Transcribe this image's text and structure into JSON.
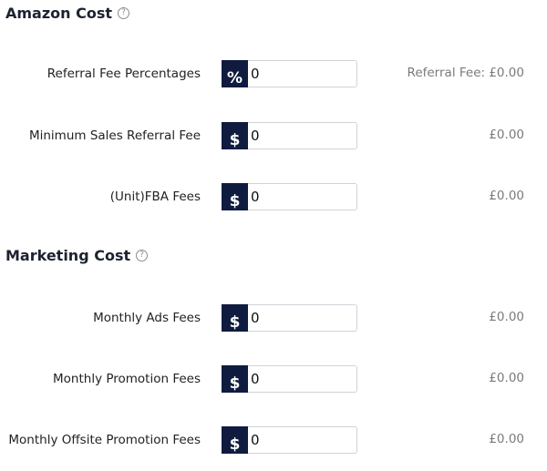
{
  "sections": [
    {
      "title": "Amazon Cost",
      "help_icon": "question-circle-icon",
      "rows": [
        {
          "label": "Referral Fee Percentages",
          "prefix": "%",
          "value": "0",
          "result": "Referral Fee: £0.00"
        },
        {
          "label": "Minimum Sales Referral Fee",
          "prefix": "$",
          "value": "0",
          "result": "£0.00"
        },
        {
          "label": "(Unit)FBA Fees",
          "prefix": "$",
          "value": "0",
          "result": "£0.00"
        }
      ]
    },
    {
      "title": "Marketing Cost",
      "help_icon": "question-circle-icon",
      "rows": [
        {
          "label": "Monthly Ads Fees",
          "prefix": "$",
          "value": "0",
          "result": "£0.00"
        },
        {
          "label": "Monthly Promotion Fees",
          "prefix": "$",
          "value": "0",
          "result": "£0.00"
        },
        {
          "label": "Monthly Offsite Promotion Fees",
          "prefix": "$",
          "value": "0",
          "result": "£0.00"
        }
      ]
    }
  ],
  "colors": {
    "prefix_bg": "#0f1c3f",
    "title_text": "#1d2230",
    "result_text": "#7a7a7a",
    "border": "#cfd3d8"
  }
}
